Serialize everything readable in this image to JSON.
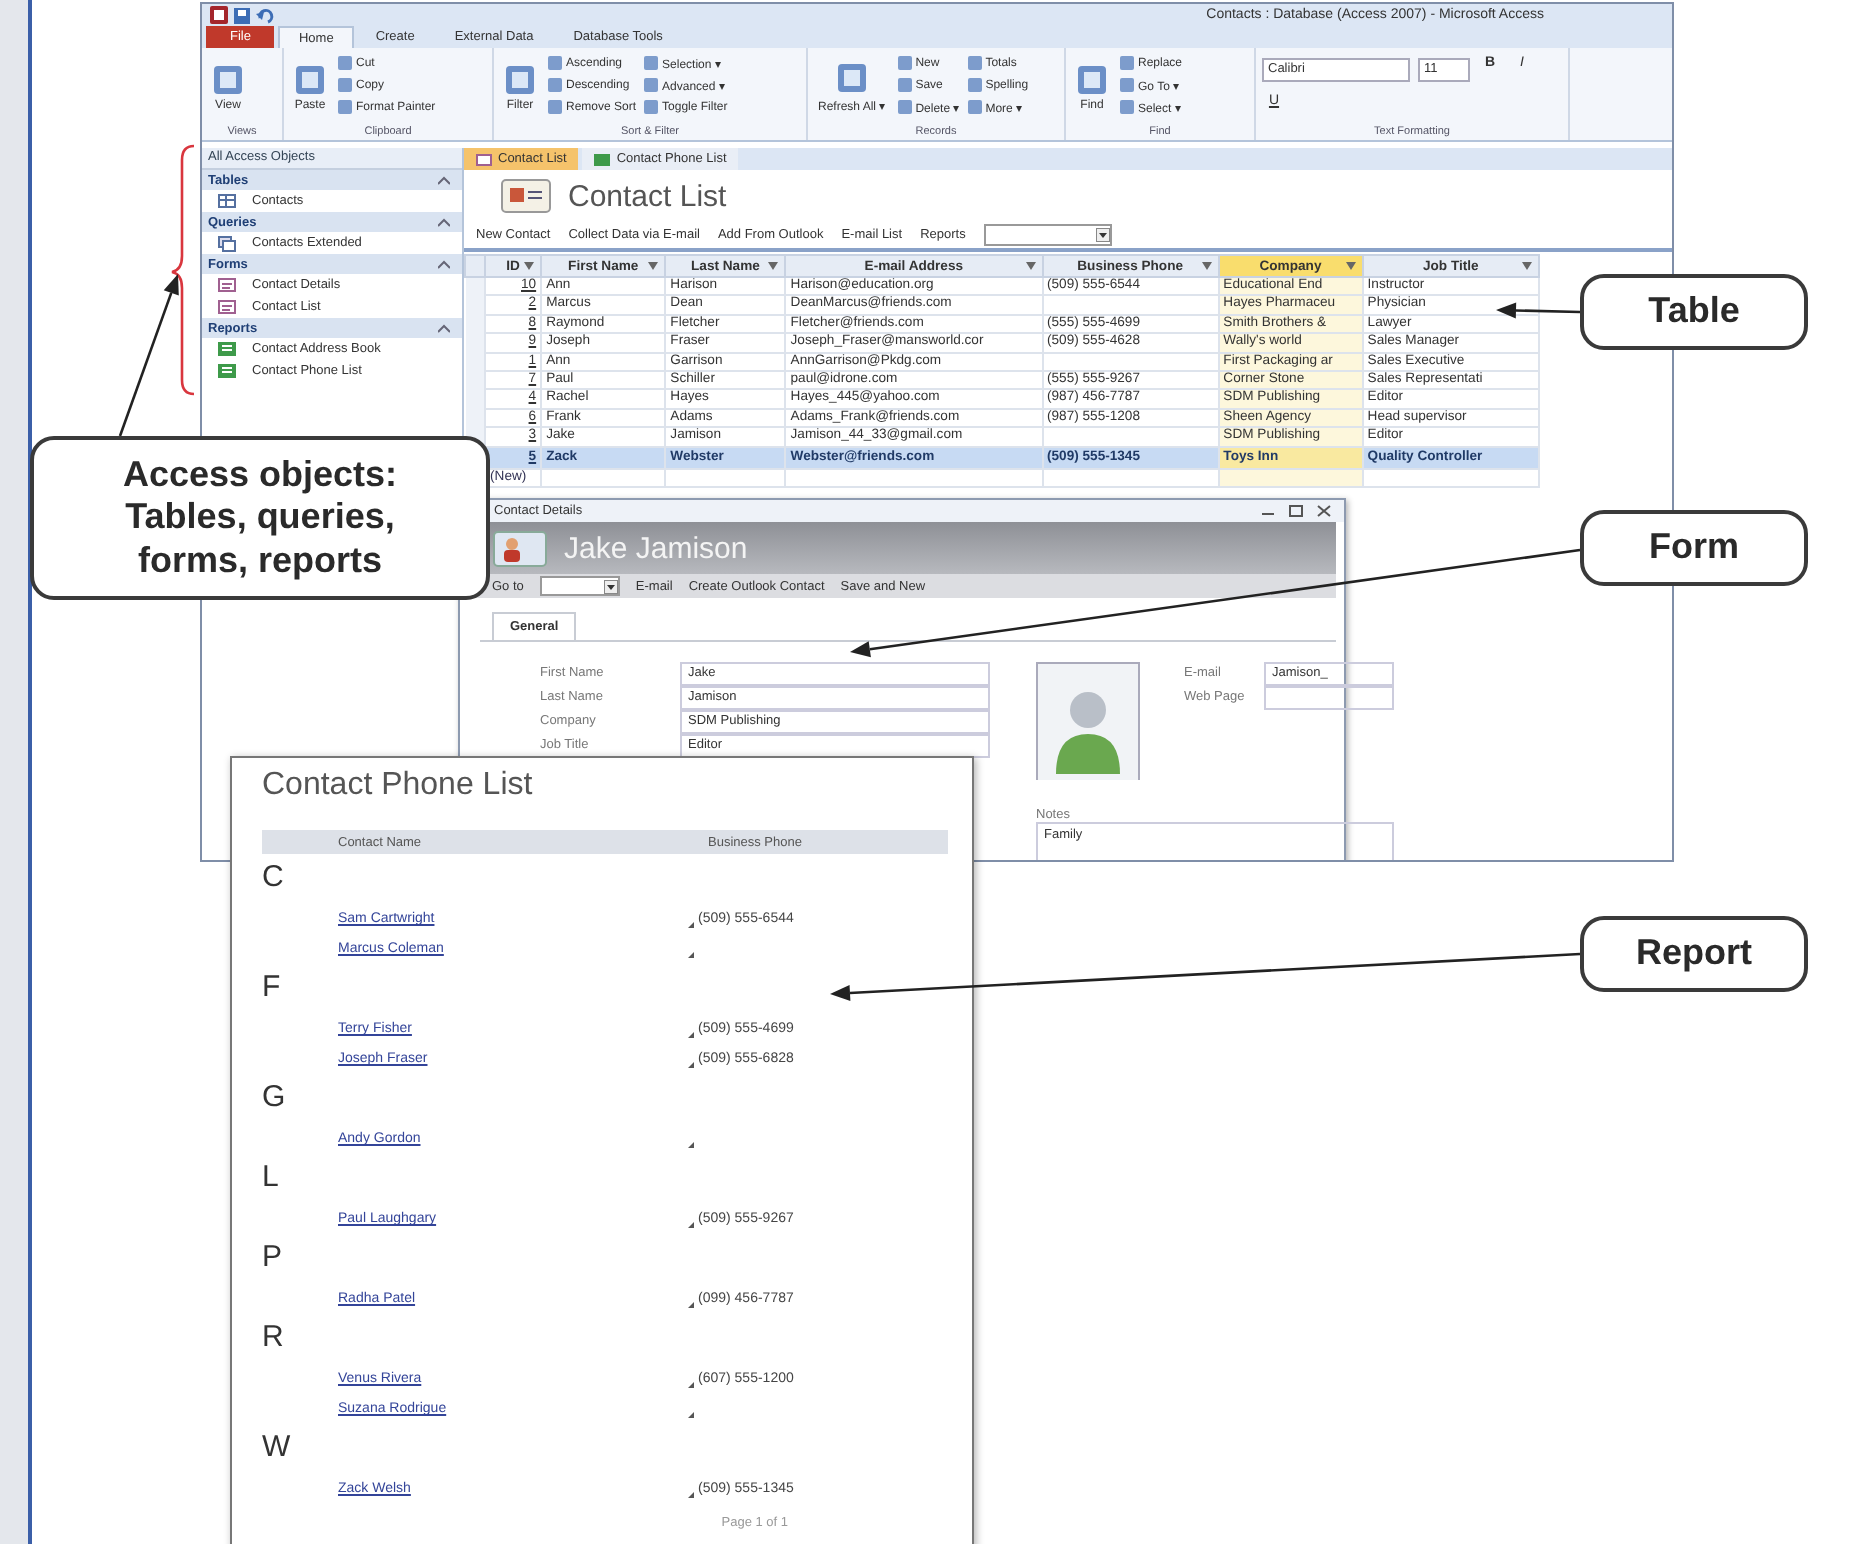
{
  "app_window": {
    "title": "Contacts : Database (Access 2007) - Microsoft Access",
    "ribbon_tabs": [
      {
        "label": "File",
        "kind": "menu",
        "selected": false
      },
      {
        "label": "Home",
        "kind": "tab",
        "selected": true
      },
      {
        "label": "Create",
        "kind": "tab",
        "selected": false
      },
      {
        "label": "External Data",
        "kind": "tab",
        "selected": false
      },
      {
        "label": "Database Tools",
        "kind": "tab",
        "selected": false
      }
    ],
    "ribbon_groups": [
      {
        "name": "Views",
        "items": [
          {
            "label": "View",
            "kind": "large"
          }
        ]
      },
      {
        "name": "Clipboard",
        "items": [
          {
            "label": "Paste",
            "kind": "large"
          },
          {
            "label": "Cut",
            "kind": "small"
          },
          {
            "label": "Copy",
            "kind": "small"
          },
          {
            "label": "Format Painter",
            "kind": "small"
          }
        ]
      },
      {
        "name": "Sort & Filter",
        "items": [
          {
            "label": "Filter",
            "kind": "large"
          },
          {
            "label": "Ascending",
            "kind": "small"
          },
          {
            "label": "Descending",
            "kind": "small"
          },
          {
            "label": "Remove Sort",
            "kind": "small"
          },
          {
            "label": "Selection ▾",
            "kind": "small"
          },
          {
            "label": "Advanced ▾",
            "kind": "small"
          },
          {
            "label": "Toggle Filter",
            "kind": "small"
          }
        ]
      },
      {
        "name": "Records",
        "items": [
          {
            "label": "Refresh All ▾",
            "kind": "large"
          },
          {
            "label": "New",
            "kind": "small"
          },
          {
            "label": "Save",
            "kind": "small"
          },
          {
            "label": "Delete ▾",
            "kind": "small"
          },
          {
            "label": "Totals",
            "kind": "small"
          },
          {
            "label": "Spelling",
            "kind": "small"
          },
          {
            "label": "More ▾",
            "kind": "small"
          }
        ]
      },
      {
        "name": "Find",
        "items": [
          {
            "label": "Find",
            "kind": "large"
          },
          {
            "label": "Replace",
            "kind": "small"
          },
          {
            "label": "Go To ▾",
            "kind": "small"
          },
          {
            "label": "Select ▾",
            "kind": "small"
          }
        ]
      },
      {
        "name": "Text Formatting",
        "items": [
          {
            "label": "Calibri",
            "kind": "font"
          },
          {
            "label": "11",
            "kind": "size"
          },
          {
            "label": "B",
            "kind": "format"
          },
          {
            "label": "I",
            "kind": "format"
          },
          {
            "label": "U",
            "kind": "format"
          }
        ]
      }
    ]
  },
  "navigation_pane": {
    "title": "All Access Objects",
    "sections": [
      {
        "label": "Tables",
        "items": [
          {
            "label": "Contacts",
            "kind": "table"
          }
        ]
      },
      {
        "label": "Queries",
        "items": [
          {
            "label": "Contacts Extended",
            "kind": "query"
          }
        ]
      },
      {
        "label": "Forms",
        "items": [
          {
            "label": "Contact Details",
            "kind": "form"
          },
          {
            "label": "Contact List",
            "kind": "form"
          }
        ]
      },
      {
        "label": "Reports",
        "items": [
          {
            "label": "Contact Address Book",
            "kind": "report"
          },
          {
            "label": "Contact Phone List",
            "kind": "report"
          }
        ]
      }
    ]
  },
  "document_tabs": [
    {
      "label": "Contact List",
      "kind": "form",
      "selected": true
    },
    {
      "label": "Contact Phone List",
      "kind": "report",
      "selected": false
    }
  ],
  "contact_list": {
    "title": "Contact List",
    "actions": [
      "New Contact",
      "Collect Data via E-mail",
      "Add From Outlook",
      "E-mail List",
      "Reports"
    ],
    "columns": [
      {
        "label": "ID",
        "selected": false
      },
      {
        "label": "First Name",
        "selected": false
      },
      {
        "label": "Last Name",
        "selected": false
      },
      {
        "label": "E-mail Address",
        "selected": false
      },
      {
        "label": "Business Phone",
        "selected": false
      },
      {
        "label": "Company",
        "selected": true
      },
      {
        "label": "Job Title",
        "selected": false
      }
    ],
    "rows": [
      {
        "id": "10",
        "first_name": "Ann",
        "last_name": "Harison",
        "email": "Harison@education.org",
        "business_phone": "(509) 555-6544",
        "company": "Educational End",
        "job_title": "Instructor",
        "selected": false
      },
      {
        "id": "2",
        "first_name": "Marcus",
        "last_name": "Dean",
        "email": "DeanMarcus@friends.com",
        "company": "Hayes Pharmaceu",
        "job_title": "Physician",
        "selected": false
      },
      {
        "id": "8",
        "first_name": "Raymond",
        "last_name": "Fletcher",
        "email": "Fletcher@friends.com",
        "business_phone": "(555) 555-4699",
        "company": "Smith Brothers &",
        "job_title": "Lawyer",
        "selected": false
      },
      {
        "id": "9",
        "first_name": "Joseph",
        "last_name": "Fraser",
        "email": "Joseph_Fraser@mansworld.cor",
        "business_phone": "(509) 555-4628",
        "company": "Wally's world",
        "job_title": "Sales Manager",
        "selected": false
      },
      {
        "id": "1",
        "first_name": "Ann",
        "last_name": "Garrison",
        "email": "AnnGarrison@Pkdg.com",
        "company": "First Packaging ar",
        "job_title": "Sales Executive",
        "selected": false
      },
      {
        "id": "7",
        "first_name": "Paul",
        "last_name": "Schiller",
        "email": "paul@idrone.com",
        "business_phone": "(555) 555-9267",
        "company": "Corner Stone",
        "job_title": "Sales Representati",
        "selected": false
      },
      {
        "id": "4",
        "first_name": "Rachel",
        "last_name": "Hayes",
        "email": "Hayes_445@yahoo.com",
        "business_phone": "(987) 456-7787",
        "company": "SDM Publishing",
        "job_title": "Editor",
        "selected": false
      },
      {
        "id": "6",
        "first_name": "Frank",
        "last_name": "Adams",
        "email": "Adams_Frank@friends.com",
        "business_phone": "(987) 555-1208",
        "company": "Sheen Agency",
        "job_title": "Head supervisor",
        "selected": false
      },
      {
        "id": "3",
        "first_name": "Jake",
        "last_name": "Jamison",
        "email": "Jamison_44_33@gmail.com",
        "company": "SDM Publishing",
        "job_title": "Editor",
        "selected": false
      },
      {
        "id": "5",
        "first_name": "Zack",
        "last_name": "Webster",
        "email": "Webster@friends.com",
        "business_phone": "(509) 555-1345",
        "company": "Toys Inn",
        "job_title": "Quality Controller",
        "selected": true
      }
    ],
    "new_row": "(New)"
  },
  "form_window": {
    "title": "Contact Details",
    "header": "Jake Jamison",
    "goto_label": "Go to",
    "actions": [
      "E-mail",
      "Create Outlook Contact",
      "Save and New"
    ],
    "tabs": [
      {
        "label": "General",
        "selected": true
      }
    ],
    "fields": [
      {
        "label": "First Name",
        "value": "Jake"
      },
      {
        "label": "Last Name",
        "value": "Jamison"
      },
      {
        "label": "Company",
        "value": "SDM Publishing"
      },
      {
        "label": "Job Title",
        "value": "Editor"
      }
    ],
    "side_fields": [
      {
        "label": "E-mail",
        "value": "Jamison_"
      },
      {
        "label": "Web Page"
      }
    ],
    "notes": {
      "label": "Notes",
      "value": "Family"
    }
  },
  "report": {
    "title": "Contact Phone List",
    "columns": [
      "Contact Name",
      "Business Phone"
    ],
    "groups": [
      {
        "letter": "C",
        "entries": [
          {
            "name": "Sam Cartwright",
            "phone": "(509) 555-6544"
          },
          {
            "name": "Marcus Coleman"
          }
        ]
      },
      {
        "letter": "F",
        "entries": [
          {
            "name": "Terry Fisher",
            "phone": "(509) 555-4699"
          },
          {
            "name": "Joseph Fraser",
            "phone": "(509) 555-6828"
          }
        ]
      },
      {
        "letter": "G",
        "entries": [
          {
            "name": "Andy Gordon"
          }
        ]
      },
      {
        "letter": "L",
        "entries": [
          {
            "name": "Paul Laughgary",
            "phone": "(509) 555-9267"
          }
        ]
      },
      {
        "letter": "P",
        "entries": [
          {
            "name": "Radha Patel",
            "phone": "(099) 456-7787"
          }
        ]
      },
      {
        "letter": "R",
        "entries": [
          {
            "name": "Venus Rivera",
            "phone": "(607) 555-1200"
          },
          {
            "name": "Suzana Rodrigue"
          }
        ]
      },
      {
        "letter": "W",
        "entries": [
          {
            "name": "Zack Welsh",
            "phone": "(509) 555-1345"
          }
        ]
      }
    ],
    "footer": "Page 1 of 1"
  },
  "callouts": [
    {
      "text": "Access objects:\nTables, queries,\nforms, reports"
    },
    {
      "text": "Table"
    },
    {
      "text": "Form"
    },
    {
      "text": "Report"
    }
  ]
}
